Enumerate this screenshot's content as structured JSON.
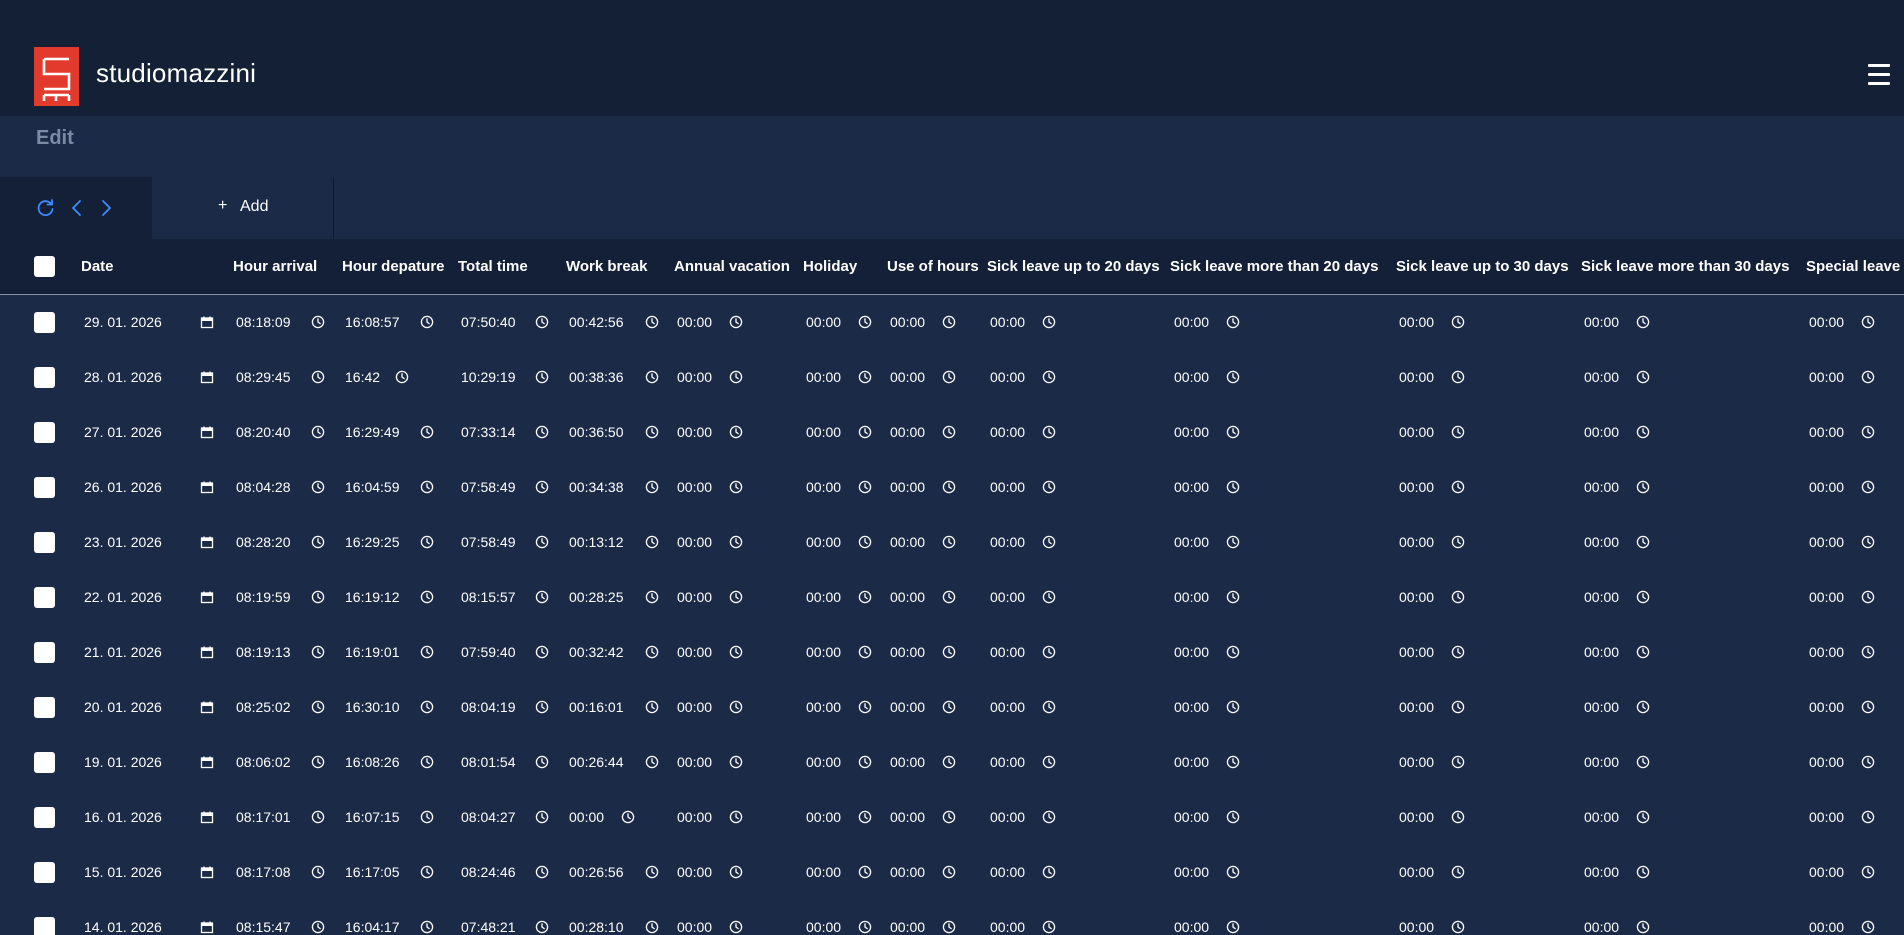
{
  "header": {
    "brand": "studiomazzini",
    "logo_color": "#e23a2c"
  },
  "page": {
    "title": "Edit"
  },
  "toolbar": {
    "add_label": "Add",
    "add_icon": "plus-icon",
    "icons": [
      "refresh-icon",
      "chevron-left-icon",
      "chevron-right-icon"
    ],
    "accent": "#3d8bff"
  },
  "table": {
    "columns": [
      "Date",
      "Hour arrival",
      "Hour depature",
      "Total time",
      "Work break",
      "Annual vacation",
      "Holiday",
      "Use of hours",
      "Sick leave up to 20 days",
      "Sick leave more than 20 days",
      "Sick leave up to 30 days",
      "Sick leave more than 30 days",
      "Special leave"
    ],
    "rows": [
      [
        "29. 01. 2026",
        "08:18:09",
        "16:08:57",
        "07:50:40",
        "00:42:56",
        "00:00",
        "00:00",
        "00:00",
        "00:00",
        "00:00",
        "00:00",
        "00:00",
        "00:00"
      ],
      [
        "28. 01. 2026",
        "08:29:45",
        "16:42",
        "10:29:19",
        "00:38:36",
        "00:00",
        "00:00",
        "00:00",
        "00:00",
        "00:00",
        "00:00",
        "00:00",
        "00:00"
      ],
      [
        "27. 01. 2026",
        "08:20:40",
        "16:29:49",
        "07:33:14",
        "00:36:50",
        "00:00",
        "00:00",
        "00:00",
        "00:00",
        "00:00",
        "00:00",
        "00:00",
        "00:00"
      ],
      [
        "26. 01. 2026",
        "08:04:28",
        "16:04:59",
        "07:58:49",
        "00:34:38",
        "00:00",
        "00:00",
        "00:00",
        "00:00",
        "00:00",
        "00:00",
        "00:00",
        "00:00"
      ],
      [
        "23. 01. 2026",
        "08:28:20",
        "16:29:25",
        "07:58:49",
        "00:13:12",
        "00:00",
        "00:00",
        "00:00",
        "00:00",
        "00:00",
        "00:00",
        "00:00",
        "00:00"
      ],
      [
        "22. 01. 2026",
        "08:19:59",
        "16:19:12",
        "08:15:57",
        "00:28:25",
        "00:00",
        "00:00",
        "00:00",
        "00:00",
        "00:00",
        "00:00",
        "00:00",
        "00:00"
      ],
      [
        "21. 01. 2026",
        "08:19:13",
        "16:19:01",
        "07:59:40",
        "00:32:42",
        "00:00",
        "00:00",
        "00:00",
        "00:00",
        "00:00",
        "00:00",
        "00:00",
        "00:00"
      ],
      [
        "20. 01. 2026",
        "08:25:02",
        "16:30:10",
        "08:04:19",
        "00:16:01",
        "00:00",
        "00:00",
        "00:00",
        "00:00",
        "00:00",
        "00:00",
        "00:00",
        "00:00"
      ],
      [
        "19. 01. 2026",
        "08:06:02",
        "16:08:26",
        "08:01:54",
        "00:26:44",
        "00:00",
        "00:00",
        "00:00",
        "00:00",
        "00:00",
        "00:00",
        "00:00",
        "00:00"
      ],
      [
        "16. 01. 2026",
        "08:17:01",
        "16:07:15",
        "08:04:27",
        "00:00",
        "00:00",
        "00:00",
        "00:00",
        "00:00",
        "00:00",
        "00:00",
        "00:00",
        "00:00"
      ],
      [
        "15. 01. 2026",
        "08:17:08",
        "16:17:05",
        "08:24:46",
        "00:26:56",
        "00:00",
        "00:00",
        "00:00",
        "00:00",
        "00:00",
        "00:00",
        "00:00",
        "00:00"
      ],
      [
        "14. 01. 2026",
        "08:15:47",
        "16:04:17",
        "07:48:21",
        "00:28:10",
        "00:00",
        "00:00",
        "00:00",
        "00:00",
        "00:00",
        "00:00",
        "00:00",
        "00:00"
      ]
    ],
    "date_icon": "calendar-icon",
    "time_icon": "clock-icon"
  }
}
